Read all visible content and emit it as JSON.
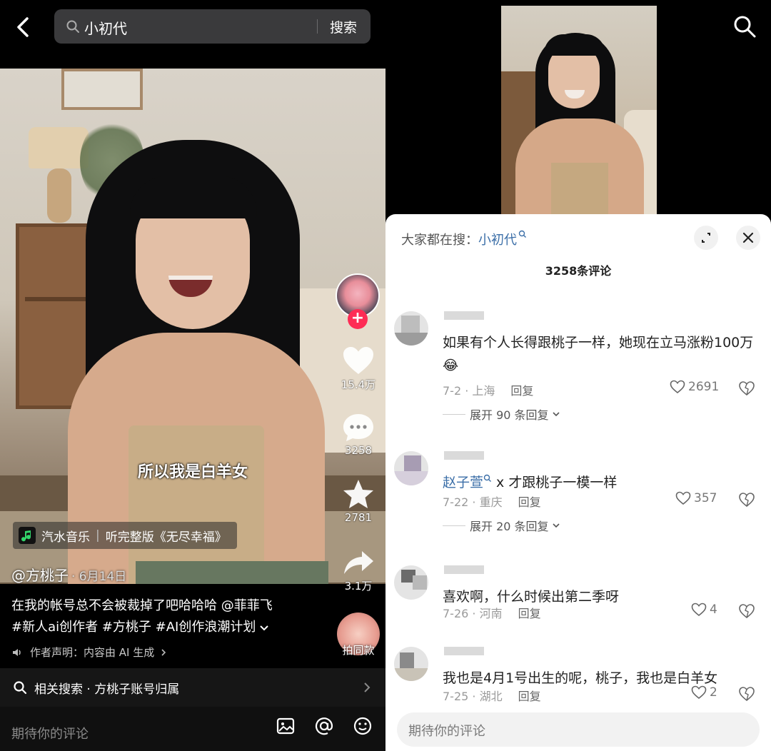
{
  "left": {
    "search": {
      "query": "小初代",
      "button": "搜索"
    },
    "video": {
      "subtitle": "所以我是白羊女",
      "music": {
        "app": "汽水音乐",
        "action": "听完整版《无尽幸福》"
      },
      "author": "@方桃子",
      "date": "· 6月14日",
      "caption_line1": "在我的帐号总不会被裁掉了吧哈哈哈 @菲菲飞",
      "caption_line2": "#新人ai创作者 #方桃子 #AI创作浪潮计划",
      "declaration": "作者声明：内容由 AI 生成",
      "rail": {
        "likes": "15.4万",
        "comments": "3258",
        "favorites": "2781",
        "shares": "3.1万",
        "disc_label": "拍同款"
      }
    },
    "related": {
      "label": "相关搜索 · 方桃子账号归属"
    },
    "comment_input": {
      "placeholder": "期待你的评论"
    }
  },
  "right": {
    "sheet": {
      "hot_prefix": "大家都在搜：",
      "hot_keyword": "小初代",
      "count": "3258条评论",
      "comments": [
        {
          "text": "如果有个人长得跟桃子一样，她现在立马涨粉100万😂",
          "date": "7-2 · 上海",
          "reply": "回复",
          "likes": "2691",
          "expand": "展开 90 条回复"
        },
        {
          "mention": "赵子萱",
          "text": " x 才跟桃子一模一样",
          "date": "7-22 · 重庆",
          "reply": "回复",
          "likes": "357",
          "expand": "展开 20 条回复"
        },
        {
          "text": "喜欢啊，什么时候出第二季呀",
          "date": "7-26 · 河南",
          "reply": "回复",
          "likes": "4"
        },
        {
          "text": "我也是4月1号出生的呢，桃子，我也是白羊女",
          "date": "7-25 · 湖北",
          "reply": "回复",
          "likes": "2"
        }
      ],
      "input_placeholder": "期待你的评论"
    }
  },
  "colors": {
    "accent_red": "#fe2c55",
    "link_blue": "#3c6fa8",
    "sheet_bg": "#ffffff"
  },
  "icons": [
    "back-icon",
    "search-icon",
    "heart-icon",
    "comment-icon",
    "star-icon",
    "share-icon",
    "image-icon",
    "at-icon",
    "emoji-icon",
    "expand-icon",
    "close-icon",
    "dislike-icon",
    "chevron-down-icon",
    "chevron-right-icon",
    "speaker-icon",
    "music-note-icon"
  ]
}
